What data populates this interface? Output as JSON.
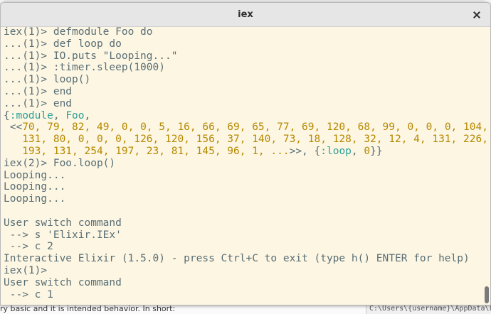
{
  "window": {
    "title": "iex"
  },
  "terminal": {
    "lines": [
      "iex(1)> defmodule Foo do",
      "...(1)> def loop do",
      "...(1)> IO.puts \"Looping...\"",
      "...(1)> :timer.sleep(1000)",
      "...(1)> loop()",
      "...(1)> end",
      "...(1)> end"
    ],
    "result_open": "{",
    "result_module_atom": ":module",
    "result_sep": ", ",
    "result_module_name": "Foo",
    "result_comma": ",",
    "binary_open": " <<",
    "binary_line1": "70, 79, 82, 49, 0, 0, 5, 16, 66, 69, 65, 77, 69, 120, 68, 99, 0, 0, 0, 104,",
    "binary_line2": "131, 80, 0, 0, 0, 126, 120, 156, 37, 140, 73, 18, 128, 32, 12, 4, 131, 226,",
    "binary_line3": "193, 131, 254, 197, 23, 81, 145, 96, 1, ...",
    "binary_close": ">>, {",
    "loop_atom": ":loop",
    "loop_sep": ", ",
    "loop_arity": "0",
    "result_close": "}}",
    "lines_after": [
      "iex(2)> Foo.loop()",
      "Looping...",
      "Looping...",
      "Looping...",
      "",
      "User switch command",
      " --> s 'Elixir.IEx'",
      " --> c 2",
      "Interactive Elixir (1.5.0) - press Ctrl+C to exit (type h() ENTER for help)",
      "iex(1)>",
      "User switch command",
      " --> c 1"
    ]
  },
  "background": {
    "bottom_text": "ry basic and it is intended behavior. In short:",
    "bottom_path": "C:\\Users\\{username}\\AppData\\Local\\Temp\\"
  },
  "colors": {
    "terminal_bg": "#fdf6e3",
    "text": "#586e75",
    "number": "#b58900",
    "atom": "#2aa198"
  }
}
